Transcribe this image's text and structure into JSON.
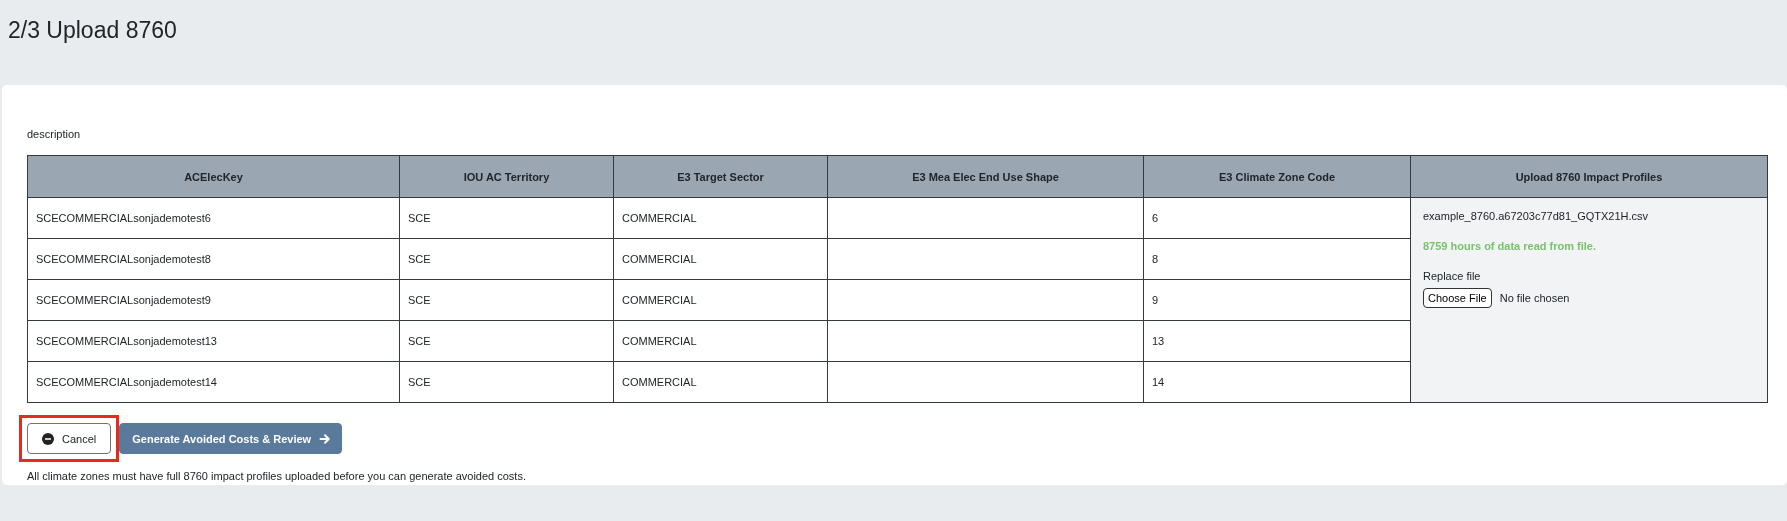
{
  "page": {
    "title": "2/3 Upload 8760"
  },
  "description": "description",
  "table": {
    "columns": [
      "ACElecKey",
      "IOU AC Territory",
      "E3 Target Sector",
      "E3 Mea Elec End Use Shape",
      "E3 Climate Zone Code",
      "Upload 8760 Impact Profiles"
    ],
    "rows": [
      {
        "cells": [
          "SCECOMMERCIALsonjademotest6",
          "SCE",
          "COMMERCIAL",
          "",
          "6"
        ]
      },
      {
        "cells": [
          "SCECOMMERCIALsonjademotest8",
          "SCE",
          "COMMERCIAL",
          "",
          "8"
        ]
      },
      {
        "cells": [
          "SCECOMMERCIALsonjademotest9",
          "SCE",
          "COMMERCIAL",
          "",
          "9"
        ]
      },
      {
        "cells": [
          "SCECOMMERCIALsonjademotest13",
          "SCE",
          "COMMERCIAL",
          "",
          "13"
        ]
      },
      {
        "cells": [
          "SCECOMMERCIALsonjademotest14",
          "SCE",
          "COMMERCIAL",
          "",
          "14"
        ]
      }
    ],
    "upload": {
      "file_name": "example_8760.a67203c77d81_GQTX21H.csv",
      "status": "8759 hours of data read from file.",
      "replace_label": "Replace file",
      "choose_button": "Choose File",
      "chosen_text": "No file chosen"
    }
  },
  "buttons": [
    {
      "kind": "cancel",
      "label": "Cancel",
      "highlighted": true
    },
    {
      "kind": "primary",
      "label": "Generate Avoided Costs & Review",
      "highlighted": false
    }
  ],
  "note": "All climate zones must have full 8760 impact profiles uploaded before you can generate avoided costs."
}
